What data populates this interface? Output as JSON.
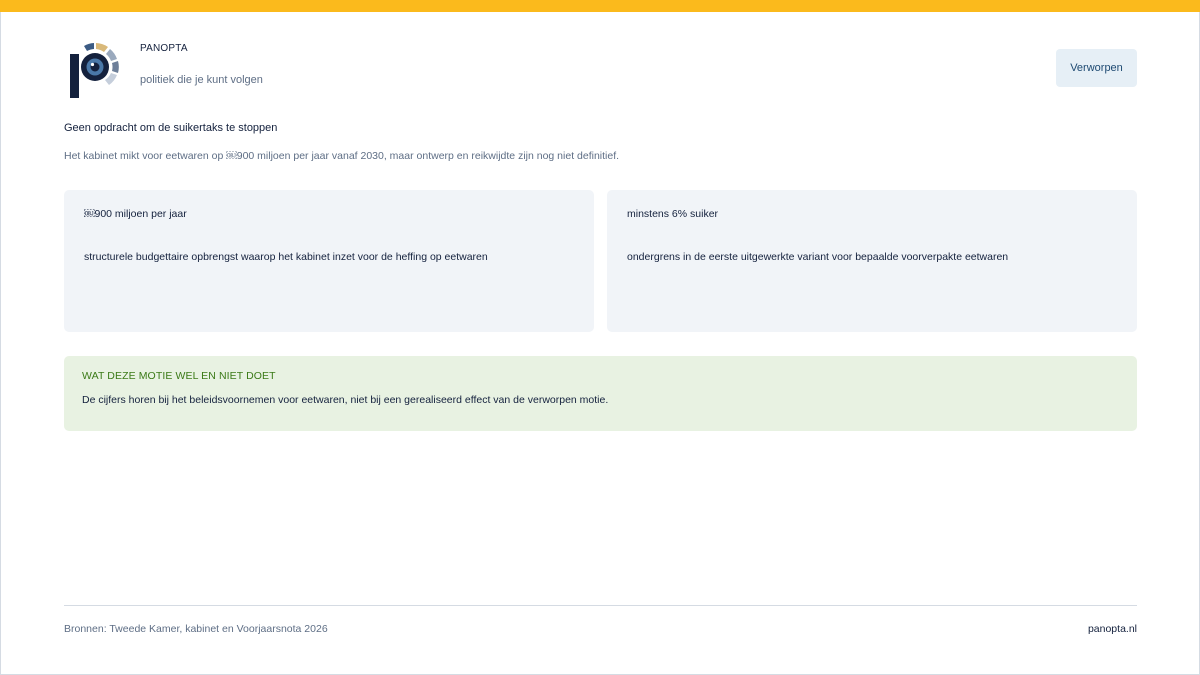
{
  "colors": {
    "accent_bar": "#fbba1c",
    "navy": "#14213d",
    "muted_text": "#5e6e85",
    "card_bg": "#f1f4f8",
    "note_bg": "#e8f2e2",
    "note_title": "#3b7a17",
    "badge_bg": "#e6eff6"
  },
  "header": {
    "logo_icon": "panopta-eye-logo-icon",
    "brand": "PANOPTA",
    "tagline": "politiek die je kunt volgen",
    "status_badge": "Verworpen"
  },
  "main": {
    "headline": "Geen opdracht om de suikertaks te stoppen",
    "subline": "Het kabinet mikt voor eetwaren op ￼900 miljoen per jaar vanaf 2030, maar ontwerp en reikwijdte zijn nog niet definitief.",
    "cards": [
      {
        "value": "￼900 miljoen per jaar",
        "description": "structurele budgettaire opbrengst waarop het kabinet inzet voor de heffing op eetwaren"
      },
      {
        "value": "minstens 6% suiker",
        "description": "ondergrens in de eerste uitgewerkte variant voor bepaalde voorverpakte eetwaren"
      }
    ],
    "note": {
      "title": "WAT DEZE MOTIE WEL EN NIET DOET",
      "body": "De cijfers horen bij het beleidsvoornemen voor eetwaren, niet bij een gerealiseerd effect van de verworpen motie."
    }
  },
  "footer": {
    "sources": "Bronnen: Tweede Kamer, kabinet en Voorjaarsnota 2026",
    "site": "panopta.nl"
  }
}
